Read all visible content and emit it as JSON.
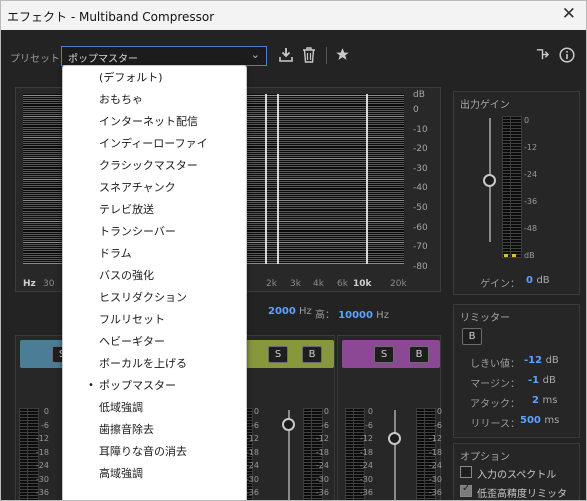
{
  "window": {
    "title": "エフェクト - Multiband Compressor",
    "close_glyph": "✕"
  },
  "toolbar": {
    "preset_label": "プリセット：",
    "preset_value": "ポップマスター",
    "icons": [
      "download-icon",
      "trash-icon",
      "star-icon",
      "routing-icon",
      "info-icon"
    ]
  },
  "graph": {
    "db_unit": "dB",
    "db_ticks": [
      "0",
      "-10",
      "-20",
      "-30",
      "-40",
      "-50",
      "-60",
      "-70",
      "-80"
    ],
    "hz_labels": [
      "Hz",
      "30",
      "2k",
      "3k",
      "4k",
      "6k",
      "10k",
      "20k"
    ],
    "crossover_lines_hz": [
      1600,
      2000,
      10000
    ]
  },
  "crossover": {
    "mid_value": "2000",
    "mid_unit": "Hz",
    "high_label": "高：",
    "high_value": "10000",
    "high_unit": "Hz"
  },
  "bands": {
    "solo_label": "S",
    "bypass_label": "B",
    "scale": [
      "0",
      "-6",
      "-12",
      "-18",
      "-24",
      "-30",
      "-36"
    ],
    "colors": [
      "#4b7e96",
      "#86973c",
      "#8c4795"
    ]
  },
  "output_gain": {
    "title": "出力ゲイン",
    "scale": [
      "0",
      "-12",
      "-24",
      "-36",
      "-48",
      "dB"
    ],
    "gain_label": "ゲイン：",
    "gain_value": "0",
    "gain_unit": "dB",
    "slider_level": 0.5
  },
  "limiter": {
    "title": "リミッター",
    "bypass_label": "B",
    "threshold_label": "しきい値：",
    "threshold_value": "-12",
    "threshold_unit": "dB",
    "margin_label": "マージン：",
    "margin_value": "-1",
    "margin_unit": "dB",
    "attack_label": "アタック：",
    "attack_value": "2",
    "attack_unit": "ms",
    "release_label": "リリース：",
    "release_value": "500",
    "release_unit": "ms"
  },
  "options": {
    "title": "オプション",
    "spectrum_label": "入力のスペクトル",
    "spectrum_checked": false,
    "precision_label": "低歪高精度リミッタ",
    "precision_checked": true
  },
  "dropdown": {
    "selected_index": 14,
    "bullet": "•",
    "items": [
      "(デフォルト)",
      "おもちゃ",
      "インターネット配信",
      "インディーローファイ",
      "クラシックマスター",
      "スネアチャンク",
      "テレビ放送",
      "トランシーバー",
      "ドラム",
      "バスの強化",
      "ヒスリダクション",
      "フルリセット",
      "ヘビーギター",
      "ボーカルを上げる",
      "ポップマスター",
      "低域強調",
      "歯擦音除去",
      "耳障りな音の消去",
      "高域強調"
    ]
  }
}
